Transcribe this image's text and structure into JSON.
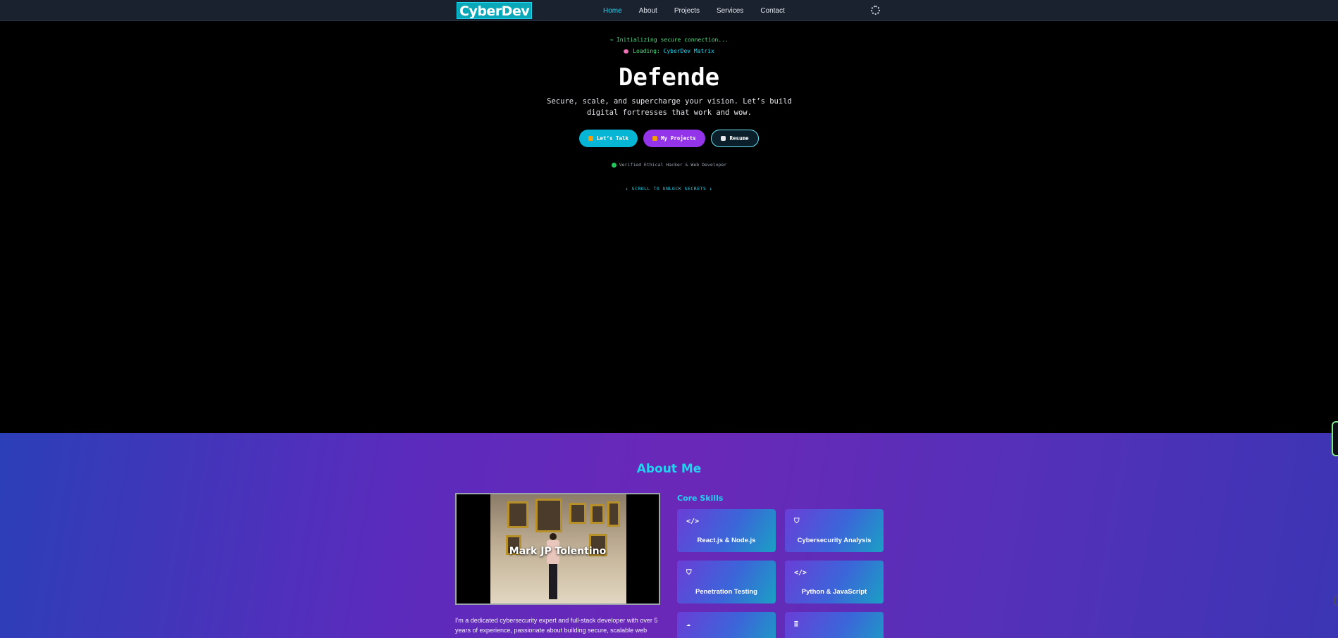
{
  "nav": {
    "logo": "CyberDev",
    "links": [
      "Home",
      "About",
      "Projects",
      "Services",
      "Contact"
    ],
    "active": "Home"
  },
  "hero": {
    "terminal_line1": "→ Initializing secure connection...",
    "terminal_line2_prefix": "Loading: ",
    "terminal_line2_highlight": "CyberDev Matrix",
    "title": "Defende",
    "subtitle": "Secure, scale, and supercharge your vision. Let’s build digital fortresses that work and wow.",
    "buttons": {
      "talk": "Let’s Talk",
      "projects": "My Projects",
      "resume": "Resume"
    },
    "verified": "Verified Ethical Hacker & Web Developer",
    "scroll_hint": "↓ SCROLL TO UNLOCK SECRETS ↓"
  },
  "about": {
    "title": "About Me",
    "photo_name": "Mark JP Tolentino",
    "text": "I'm a dedicated cybersecurity expert and full-stack developer with over 5 years of experience, passionate about building secure, scalable web",
    "skills_title": "Core Skills",
    "skills": [
      {
        "icon": "code-icon",
        "glyph": "</>",
        "label": "React.js & Node.js"
      },
      {
        "icon": "shield-icon",
        "glyph": "⛉",
        "label": "Cybersecurity Analysis"
      },
      {
        "icon": "shield-icon",
        "glyph": "⛉",
        "label": "Penetration Testing"
      },
      {
        "icon": "code-icon",
        "glyph": "</>",
        "label": "Python & JavaScript"
      },
      {
        "icon": "cloud-icon",
        "glyph": "☁",
        "label": ""
      },
      {
        "icon": "database-icon",
        "glyph": "≣",
        "label": ""
      }
    ]
  },
  "colors": {
    "accent": "#22d3ee",
    "terminal_green": "#4ade80",
    "button_purple": "#9333ea"
  }
}
